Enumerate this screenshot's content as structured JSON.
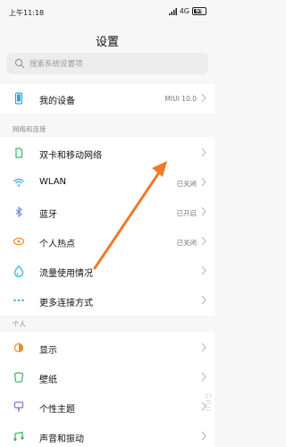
{
  "status_bar": {
    "time": "上午11:18",
    "network": "4G",
    "battery": "69"
  },
  "header": {
    "title": "设置"
  },
  "search": {
    "placeholder": "搜索系统设置项"
  },
  "device": {
    "label": "我的设备",
    "value": "MIUI 10.0"
  },
  "sections": {
    "network": {
      "header": "网络和连接",
      "items": [
        {
          "label": "双卡和移动网络",
          "value": "",
          "icon": "sim-card-icon"
        },
        {
          "label": "WLAN",
          "value": "已关闭",
          "icon": "wifi-icon"
        },
        {
          "label": "蓝牙",
          "value": "已开启",
          "icon": "bluetooth-icon"
        },
        {
          "label": "个人热点",
          "value": "已关闭",
          "icon": "hotspot-icon"
        },
        {
          "label": "流量使用情况",
          "value": "",
          "icon": "data-usage-icon"
        },
        {
          "label": "更多连接方式",
          "value": "",
          "icon": "more-connections-icon"
        }
      ]
    },
    "personal": {
      "header": "个人",
      "items": [
        {
          "label": "显示",
          "value": "",
          "icon": "display-icon"
        },
        {
          "label": "壁纸",
          "value": "",
          "icon": "wallpaper-icon"
        },
        {
          "label": "个性主题",
          "value": "",
          "icon": "theme-icon"
        },
        {
          "label": "声音和振动",
          "value": "",
          "icon": "sound-icon"
        }
      ]
    }
  },
  "watermark": "GIUI",
  "colors": {
    "accent_arrow": "#f07a2a",
    "background": "#f7f7f7"
  }
}
